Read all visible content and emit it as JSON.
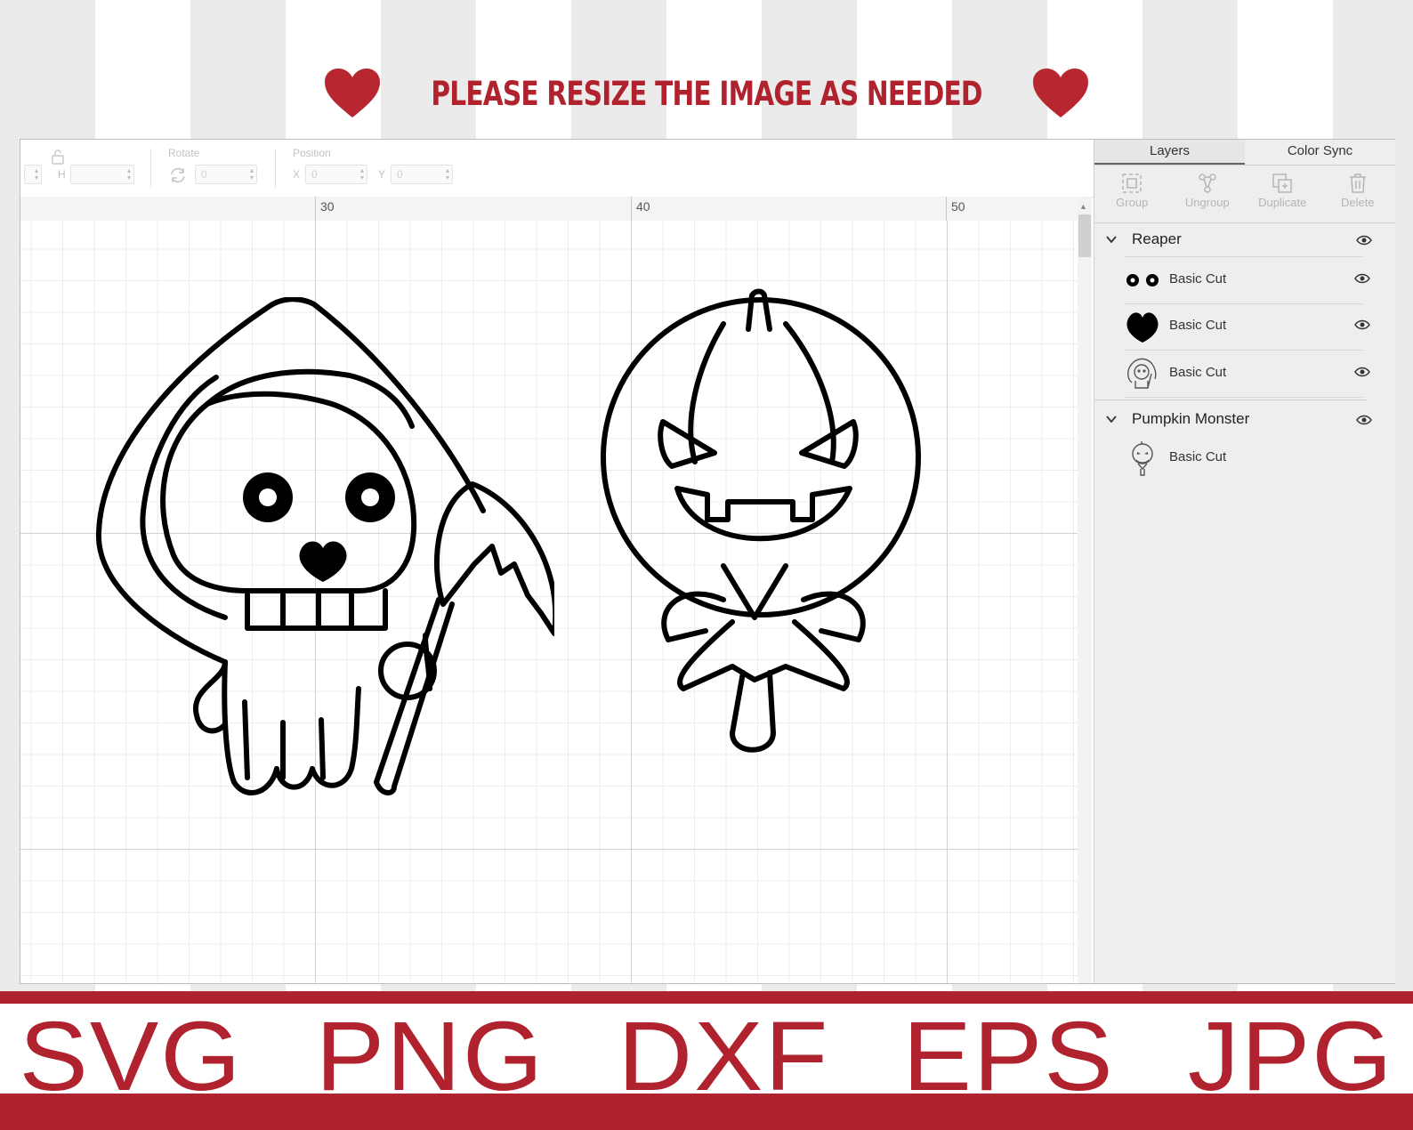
{
  "banner": {
    "title": "PLEASE RESIZE THE IMAGE AS NEEDED",
    "color": "#b0222e",
    "formats": "SVG PNG DXF EPS JPG"
  },
  "toolbar": {
    "size_h_label": "H",
    "rotate_label": "Rotate",
    "rotate_value": "0",
    "position_label": "Position",
    "x_label": "X",
    "x_value": "0",
    "y_label": "Y",
    "y_value": "0"
  },
  "ruler": {
    "ticks": [
      "30",
      "40",
      "50"
    ]
  },
  "panel": {
    "tabs": [
      {
        "label": "Layers",
        "active": true
      },
      {
        "label": "Color Sync",
        "active": false
      }
    ],
    "actions": [
      {
        "label": "Group",
        "icon": "group-icon"
      },
      {
        "label": "Ungroup",
        "icon": "ungroup-icon"
      },
      {
        "label": "Duplicate",
        "icon": "duplicate-icon"
      },
      {
        "label": "Delete",
        "icon": "trash-icon"
      }
    ],
    "groups": [
      {
        "name": "Reaper",
        "layers": [
          {
            "name": "Basic Cut",
            "thumb": "eyes-thumbnail"
          },
          {
            "name": "Basic Cut",
            "thumb": "nose-thumbnail"
          },
          {
            "name": "Basic Cut",
            "thumb": "reaper-thumbnail"
          }
        ]
      },
      {
        "name": "Pumpkin Monster",
        "layers": [
          {
            "name": "Basic Cut",
            "thumb": "pumpkin-thumbnail"
          }
        ]
      }
    ]
  }
}
